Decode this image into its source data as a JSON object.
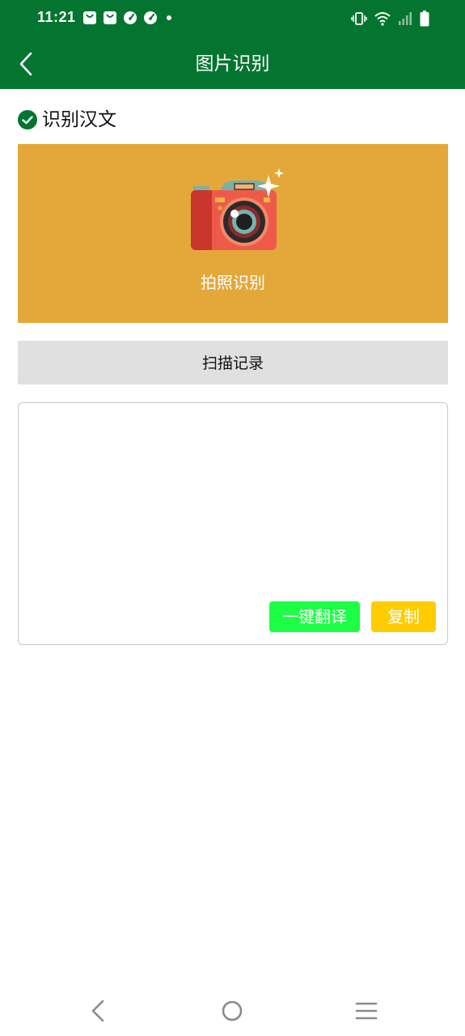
{
  "status_bar": {
    "time": "11:21",
    "left_icons": [
      "shopping-bag-icon",
      "shopping-bag-icon",
      "speedometer-icon",
      "speedometer-icon",
      "notification-dot-icon"
    ],
    "right_icons": [
      "vibrate-icon",
      "wifi-icon",
      "cellular-signal-icon",
      "battery-icon"
    ]
  },
  "toolbar": {
    "title": "图片识别",
    "back_icon": "chevron-left-icon"
  },
  "section": {
    "title": "识别汉文",
    "icon": "check-circle-icon"
  },
  "capture": {
    "label": "拍照识别",
    "icon": "camera-icon"
  },
  "history": {
    "label": "扫描记录"
  },
  "result": {
    "value": "",
    "translate_label": "一键翻译",
    "copy_label": "复制"
  },
  "nav": {
    "icons": [
      "back-triangle-icon",
      "home-circle-icon",
      "menu-icon"
    ]
  },
  "colors": {
    "primary": "#047530",
    "capture_background": "#e4a83a",
    "history_background": "#e0e0e0",
    "translate_button": "#1cff44",
    "copy_button": "#ffcc00"
  }
}
